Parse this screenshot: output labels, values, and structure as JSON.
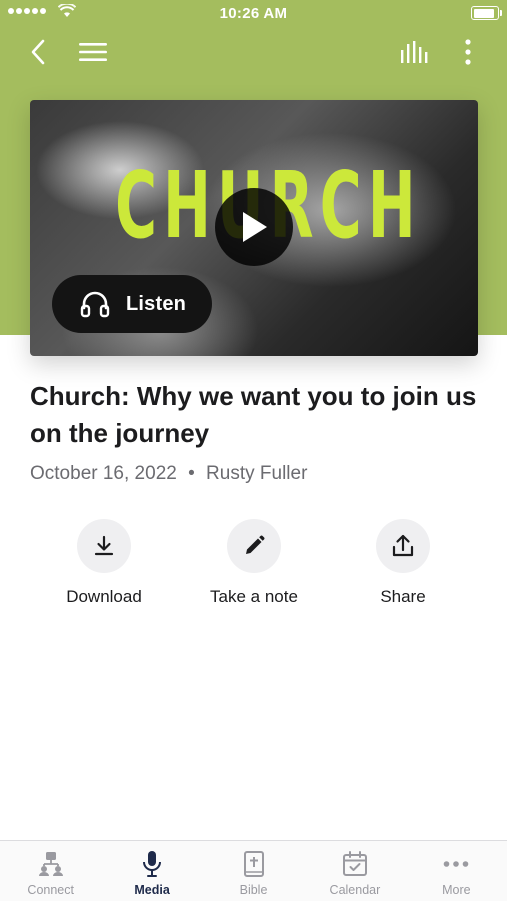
{
  "status_bar": {
    "time": "10:26 AM"
  },
  "colors": {
    "accent": "#a4bd5e",
    "artwork_text": "#cce83a",
    "tab_active": "#1e2a4a"
  },
  "media": {
    "artwork_text": "CHURCH",
    "listen_label": "Listen",
    "title": "Church: Why we want you to join us on the journey",
    "date": "October 16, 2022",
    "separator": "•",
    "speaker": "Rusty Fuller"
  },
  "actions": [
    {
      "label": "Download",
      "icon": "download-icon"
    },
    {
      "label": "Take a note",
      "icon": "pencil-icon"
    },
    {
      "label": "Share",
      "icon": "share-icon"
    }
  ],
  "tabs": [
    {
      "label": "Connect",
      "icon": "connect-icon",
      "active": false
    },
    {
      "label": "Media",
      "icon": "microphone-icon",
      "active": true
    },
    {
      "label": "Bible",
      "icon": "bible-icon",
      "active": false
    },
    {
      "label": "Calendar",
      "icon": "calendar-icon",
      "active": false
    },
    {
      "label": "More",
      "icon": "more-dots-icon",
      "active": false
    }
  ]
}
